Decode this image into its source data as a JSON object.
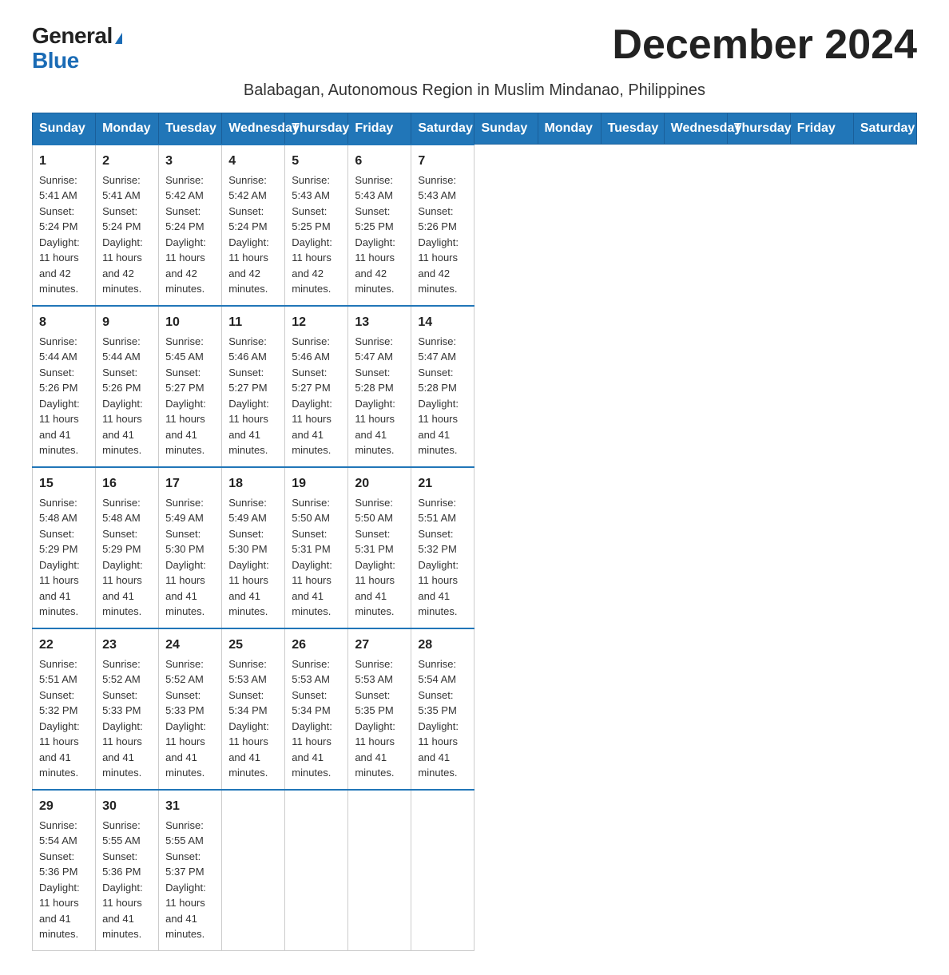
{
  "logo": {
    "general": "General",
    "blue": "Blue"
  },
  "title": "December 2024",
  "subtitle": "Balabagan, Autonomous Region in Muslim Mindanao, Philippines",
  "weekdays": [
    "Sunday",
    "Monday",
    "Tuesday",
    "Wednesday",
    "Thursday",
    "Friday",
    "Saturday"
  ],
  "weeks": [
    [
      {
        "day": "1",
        "sunrise": "5:41 AM",
        "sunset": "5:24 PM",
        "daylight": "11 hours and 42 minutes."
      },
      {
        "day": "2",
        "sunrise": "5:41 AM",
        "sunset": "5:24 PM",
        "daylight": "11 hours and 42 minutes."
      },
      {
        "day": "3",
        "sunrise": "5:42 AM",
        "sunset": "5:24 PM",
        "daylight": "11 hours and 42 minutes."
      },
      {
        "day": "4",
        "sunrise": "5:42 AM",
        "sunset": "5:24 PM",
        "daylight": "11 hours and 42 minutes."
      },
      {
        "day": "5",
        "sunrise": "5:43 AM",
        "sunset": "5:25 PM",
        "daylight": "11 hours and 42 minutes."
      },
      {
        "day": "6",
        "sunrise": "5:43 AM",
        "sunset": "5:25 PM",
        "daylight": "11 hours and 42 minutes."
      },
      {
        "day": "7",
        "sunrise": "5:43 AM",
        "sunset": "5:26 PM",
        "daylight": "11 hours and 42 minutes."
      }
    ],
    [
      {
        "day": "8",
        "sunrise": "5:44 AM",
        "sunset": "5:26 PM",
        "daylight": "11 hours and 41 minutes."
      },
      {
        "day": "9",
        "sunrise": "5:44 AM",
        "sunset": "5:26 PM",
        "daylight": "11 hours and 41 minutes."
      },
      {
        "day": "10",
        "sunrise": "5:45 AM",
        "sunset": "5:27 PM",
        "daylight": "11 hours and 41 minutes."
      },
      {
        "day": "11",
        "sunrise": "5:46 AM",
        "sunset": "5:27 PM",
        "daylight": "11 hours and 41 minutes."
      },
      {
        "day": "12",
        "sunrise": "5:46 AM",
        "sunset": "5:27 PM",
        "daylight": "11 hours and 41 minutes."
      },
      {
        "day": "13",
        "sunrise": "5:47 AM",
        "sunset": "5:28 PM",
        "daylight": "11 hours and 41 minutes."
      },
      {
        "day": "14",
        "sunrise": "5:47 AM",
        "sunset": "5:28 PM",
        "daylight": "11 hours and 41 minutes."
      }
    ],
    [
      {
        "day": "15",
        "sunrise": "5:48 AM",
        "sunset": "5:29 PM",
        "daylight": "11 hours and 41 minutes."
      },
      {
        "day": "16",
        "sunrise": "5:48 AM",
        "sunset": "5:29 PM",
        "daylight": "11 hours and 41 minutes."
      },
      {
        "day": "17",
        "sunrise": "5:49 AM",
        "sunset": "5:30 PM",
        "daylight": "11 hours and 41 minutes."
      },
      {
        "day": "18",
        "sunrise": "5:49 AM",
        "sunset": "5:30 PM",
        "daylight": "11 hours and 41 minutes."
      },
      {
        "day": "19",
        "sunrise": "5:50 AM",
        "sunset": "5:31 PM",
        "daylight": "11 hours and 41 minutes."
      },
      {
        "day": "20",
        "sunrise": "5:50 AM",
        "sunset": "5:31 PM",
        "daylight": "11 hours and 41 minutes."
      },
      {
        "day": "21",
        "sunrise": "5:51 AM",
        "sunset": "5:32 PM",
        "daylight": "11 hours and 41 minutes."
      }
    ],
    [
      {
        "day": "22",
        "sunrise": "5:51 AM",
        "sunset": "5:32 PM",
        "daylight": "11 hours and 41 minutes."
      },
      {
        "day": "23",
        "sunrise": "5:52 AM",
        "sunset": "5:33 PM",
        "daylight": "11 hours and 41 minutes."
      },
      {
        "day": "24",
        "sunrise": "5:52 AM",
        "sunset": "5:33 PM",
        "daylight": "11 hours and 41 minutes."
      },
      {
        "day": "25",
        "sunrise": "5:53 AM",
        "sunset": "5:34 PM",
        "daylight": "11 hours and 41 minutes."
      },
      {
        "day": "26",
        "sunrise": "5:53 AM",
        "sunset": "5:34 PM",
        "daylight": "11 hours and 41 minutes."
      },
      {
        "day": "27",
        "sunrise": "5:53 AM",
        "sunset": "5:35 PM",
        "daylight": "11 hours and 41 minutes."
      },
      {
        "day": "28",
        "sunrise": "5:54 AM",
        "sunset": "5:35 PM",
        "daylight": "11 hours and 41 minutes."
      }
    ],
    [
      {
        "day": "29",
        "sunrise": "5:54 AM",
        "sunset": "5:36 PM",
        "daylight": "11 hours and 41 minutes."
      },
      {
        "day": "30",
        "sunrise": "5:55 AM",
        "sunset": "5:36 PM",
        "daylight": "11 hours and 41 minutes."
      },
      {
        "day": "31",
        "sunrise": "5:55 AM",
        "sunset": "5:37 PM",
        "daylight": "11 hours and 41 minutes."
      },
      null,
      null,
      null,
      null
    ]
  ]
}
